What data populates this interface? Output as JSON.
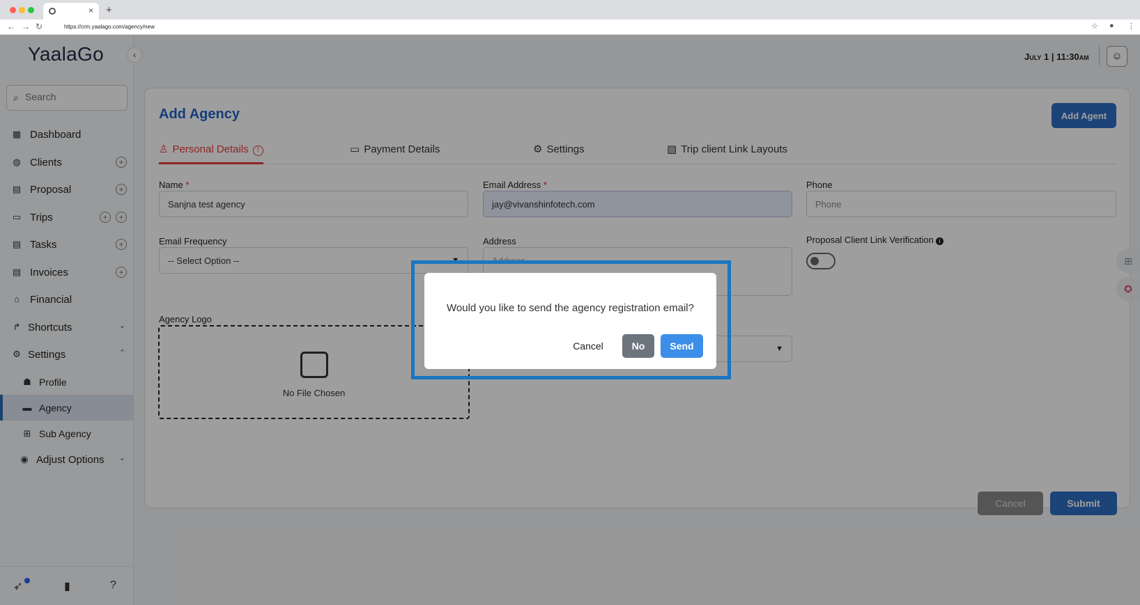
{
  "browser": {
    "tab_close": "×",
    "new_tab": "+",
    "url": "https://crm.yaalago.com/agency/new"
  },
  "app": {
    "logo": "YaalaGo",
    "datetime": "July 1 | 11:30am",
    "search_placeholder": "Search"
  },
  "sidebar": {
    "items": [
      {
        "label": "Dashboard",
        "icon": "dashboard-icon"
      },
      {
        "label": "Clients",
        "icon": "clients-icon"
      },
      {
        "label": "Proposal",
        "icon": "proposal-icon"
      },
      {
        "label": "Trips",
        "icon": "trips-icon"
      },
      {
        "label": "Tasks",
        "icon": "tasks-icon"
      },
      {
        "label": "Invoices",
        "icon": "invoices-icon"
      },
      {
        "label": "Financial",
        "icon": "bank-icon"
      },
      {
        "label": "Shortcuts",
        "icon": "share-icon"
      },
      {
        "label": "Settings",
        "icon": "gear-icon"
      }
    ],
    "sub_items": [
      {
        "label": "Profile",
        "icon": "users-icon"
      },
      {
        "label": "Agency",
        "icon": "agency-icon"
      },
      {
        "label": "Sub Agency",
        "icon": "hierarchy-icon"
      }
    ],
    "adjust_options": "Adjust Options"
  },
  "form": {
    "title": "Add Agency",
    "add_agent": "Add Agent",
    "tabs": [
      "Personal Details",
      "Payment Details",
      "Settings",
      "Trip client Link Layouts"
    ],
    "name_label": "Name",
    "name_value": "Sanjna test agency",
    "email_label": "Email Address",
    "email_value": "jay@vivanshinfotech.com",
    "phone_label": "Phone",
    "phone_placeholder": "Phone",
    "freq_label": "Email Frequency",
    "freq_value": "-- Select Option --",
    "address_label": "Address",
    "address_placeholder": "Address",
    "verification_label": "Proposal Client Link Verification",
    "logo_label": "Agency Logo",
    "no_file": "No File Chosen",
    "cancel": "Cancel",
    "submit": "Submit"
  },
  "dialog": {
    "message": "Would you like to send the agency registration email?",
    "cancel": "Cancel",
    "no": "No",
    "send": "Send"
  },
  "colors": {
    "accent": "#2f6fc4",
    "active_tab": "#e23a3a",
    "highlight": "#1b76c2"
  }
}
